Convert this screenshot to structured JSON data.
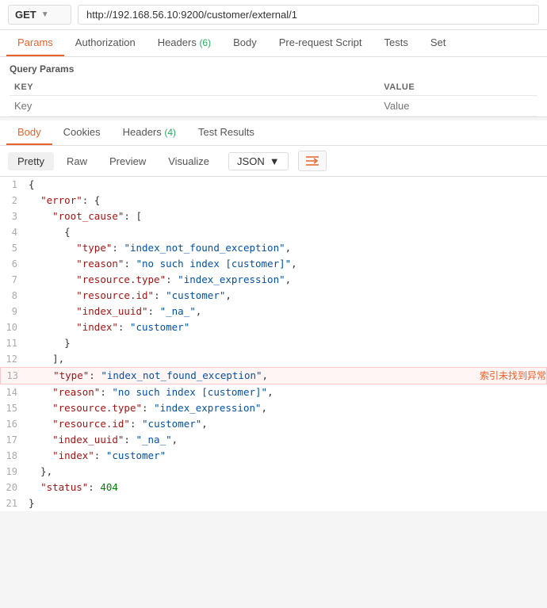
{
  "topbar": {
    "method": "GET",
    "method_arrow": "▼",
    "url": "http://192.168.56.10:9200/customer/external/1"
  },
  "request_tabs": [
    {
      "label": "Params",
      "active": true,
      "badge": ""
    },
    {
      "label": "Authorization",
      "active": false,
      "badge": ""
    },
    {
      "label": "Headers",
      "active": false,
      "badge": "(6)"
    },
    {
      "label": "Body",
      "active": false,
      "badge": ""
    },
    {
      "label": "Pre-request Script",
      "active": false,
      "badge": ""
    },
    {
      "label": "Tests",
      "active": false,
      "badge": ""
    },
    {
      "label": "Set",
      "active": false,
      "badge": ""
    }
  ],
  "query_params": {
    "title": "Query Params",
    "columns": [
      "KEY",
      "VALUE"
    ],
    "placeholder_key": "Key",
    "placeholder_value": "Value"
  },
  "response_tabs": [
    {
      "label": "Body",
      "active": true
    },
    {
      "label": "Cookies",
      "active": false
    },
    {
      "label": "Headers",
      "active": false,
      "badge": "(4)"
    },
    {
      "label": "Test Results",
      "active": false
    }
  ],
  "format_bar": {
    "pretty": "Pretty",
    "raw": "Raw",
    "preview": "Preview",
    "visualize": "Visualize",
    "json_label": "JSON",
    "json_arrow": "▼",
    "wrap_icon": "≡"
  },
  "code_lines": [
    {
      "num": 1,
      "content": "{",
      "highlight": false
    },
    {
      "num": 2,
      "content": "  \"error\": {",
      "highlight": false
    },
    {
      "num": 3,
      "content": "    \"root_cause\": [",
      "highlight": false
    },
    {
      "num": 4,
      "content": "      {",
      "highlight": false
    },
    {
      "num": 5,
      "content": "        \"type\": \"index_not_found_exception\",",
      "highlight": false
    },
    {
      "num": 6,
      "content": "        \"reason\": \"no such index [customer]\",",
      "highlight": false
    },
    {
      "num": 7,
      "content": "        \"resource.type\": \"index_expression\",",
      "highlight": false
    },
    {
      "num": 8,
      "content": "        \"resource.id\": \"customer\",",
      "highlight": false
    },
    {
      "num": 9,
      "content": "        \"index_uuid\": \"_na_\",",
      "highlight": false
    },
    {
      "num": 10,
      "content": "        \"index\": \"customer\"",
      "highlight": false
    },
    {
      "num": 11,
      "content": "      }",
      "highlight": false
    },
    {
      "num": 12,
      "content": "    ],",
      "highlight": false
    },
    {
      "num": 13,
      "content": "    \"type\": \"index_not_found_exception\",",
      "highlight": true,
      "annotation": "索引未找到异常"
    },
    {
      "num": 14,
      "content": "    \"reason\": \"no such index [customer]\",",
      "highlight": false
    },
    {
      "num": 15,
      "content": "    \"resource.type\": \"index_expression\",",
      "highlight": false
    },
    {
      "num": 16,
      "content": "    \"resource.id\": \"customer\",",
      "highlight": false
    },
    {
      "num": 17,
      "content": "    \"index_uuid\": \"_na_\",",
      "highlight": false
    },
    {
      "num": 18,
      "content": "    \"index\": \"customer\"",
      "highlight": false
    },
    {
      "num": 19,
      "content": "  },",
      "highlight": false
    },
    {
      "num": 20,
      "content": "  \"status\": 404",
      "highlight": false
    },
    {
      "num": 21,
      "content": "}",
      "highlight": false
    }
  ]
}
